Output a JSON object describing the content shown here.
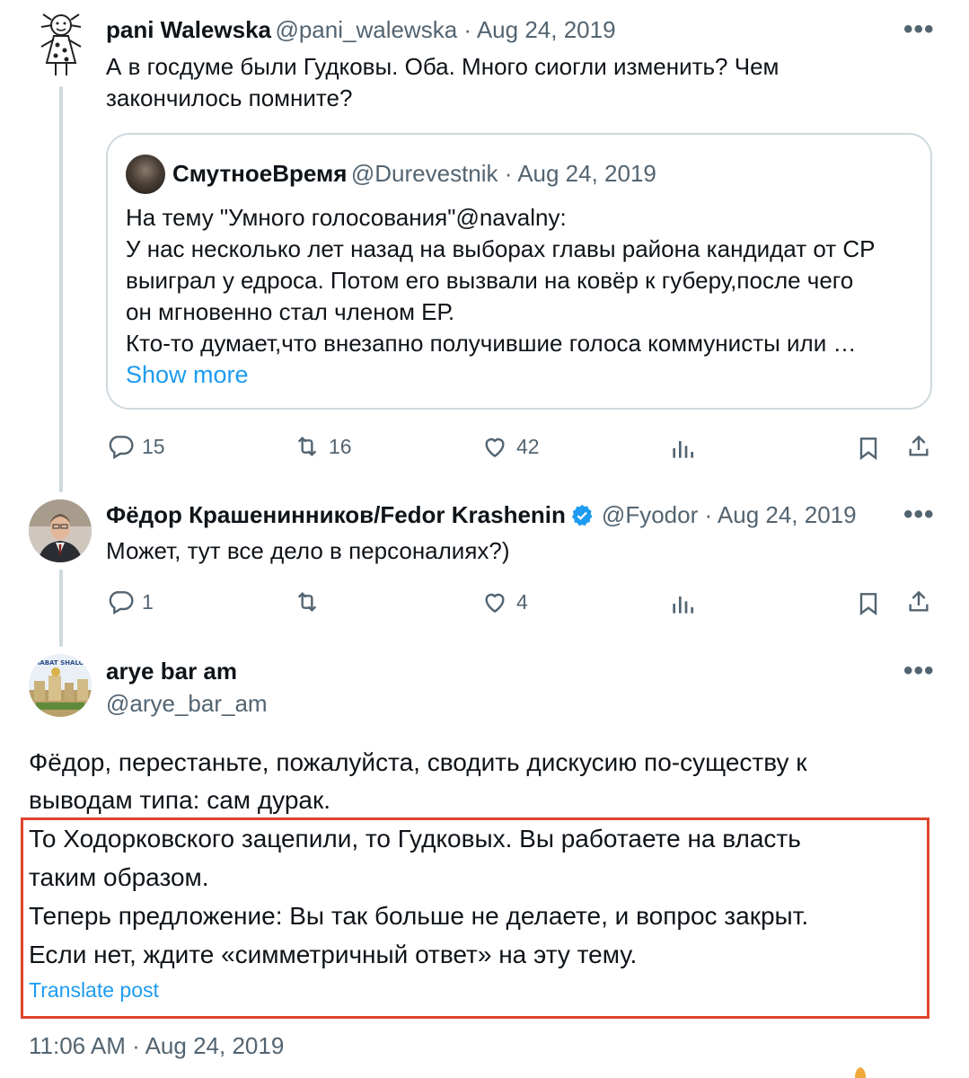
{
  "tweet1": {
    "display_name": "pani Walewska",
    "meta": "@pani_walewska · Aug 24, 2019",
    "text_line1": "А в госдуме были Гудковы. Оба. Много сиогли изменить? Чем",
    "text_line2": "закончилось помните?",
    "quote": {
      "display_name": "СмутноеВремя",
      "meta": "@Durevestnik · Aug 24, 2019",
      "lines": [
        "На тему \"Умного голосования\"@navalny:",
        "У нас несколько лет назад на выборах главы района кандидат от СР",
        "выиграл у едроса. Потом его вызвали на ковёр к губеру,после чего",
        "он мгновенно стал членом ЕР.",
        "Кто-то думает,что внезапно получившие голоса коммунисты или …"
      ],
      "show_more": "Show more"
    },
    "actions": {
      "replies": "15",
      "reposts": "16",
      "likes": "42"
    }
  },
  "tweet2": {
    "display_name": "Фёдор Крашенинников/Fedor Krashenin",
    "meta": "@Fyodor · Aug 24, 2019",
    "text": "Может, тут все дело в персоналиях?)",
    "actions": {
      "replies": "1",
      "reposts": "",
      "likes": "4"
    }
  },
  "tweet3": {
    "display_name": "arye bar am",
    "handle": "@arye_bar_am",
    "avatar_text": "SHABAT SHALOM",
    "text_line1": "Фёдор, перестаньте, пожалуйста, сводить дискусию по-существу к",
    "text_line2": "выводам типа: сам дурак.",
    "text_line3": "То Ходорковского зацепили, то Гудковых. Вы работаете на власть",
    "text_line4": "таким образом.",
    "text_line5": "Теперь предложение: Вы так больше не делаете, и вопрос закрыт.",
    "text_line6": "Если нет, ждите «симметричный ответ» на эту тему.",
    "translate": "Translate post",
    "timestamp": "11:06 AM · Aug 24, 2019"
  },
  "more_glyph": "•••",
  "colors": {
    "link": "#1d9bf0",
    "secondary": "#536471",
    "highlight": "#e0442b",
    "verified": "#1d9bf0"
  }
}
